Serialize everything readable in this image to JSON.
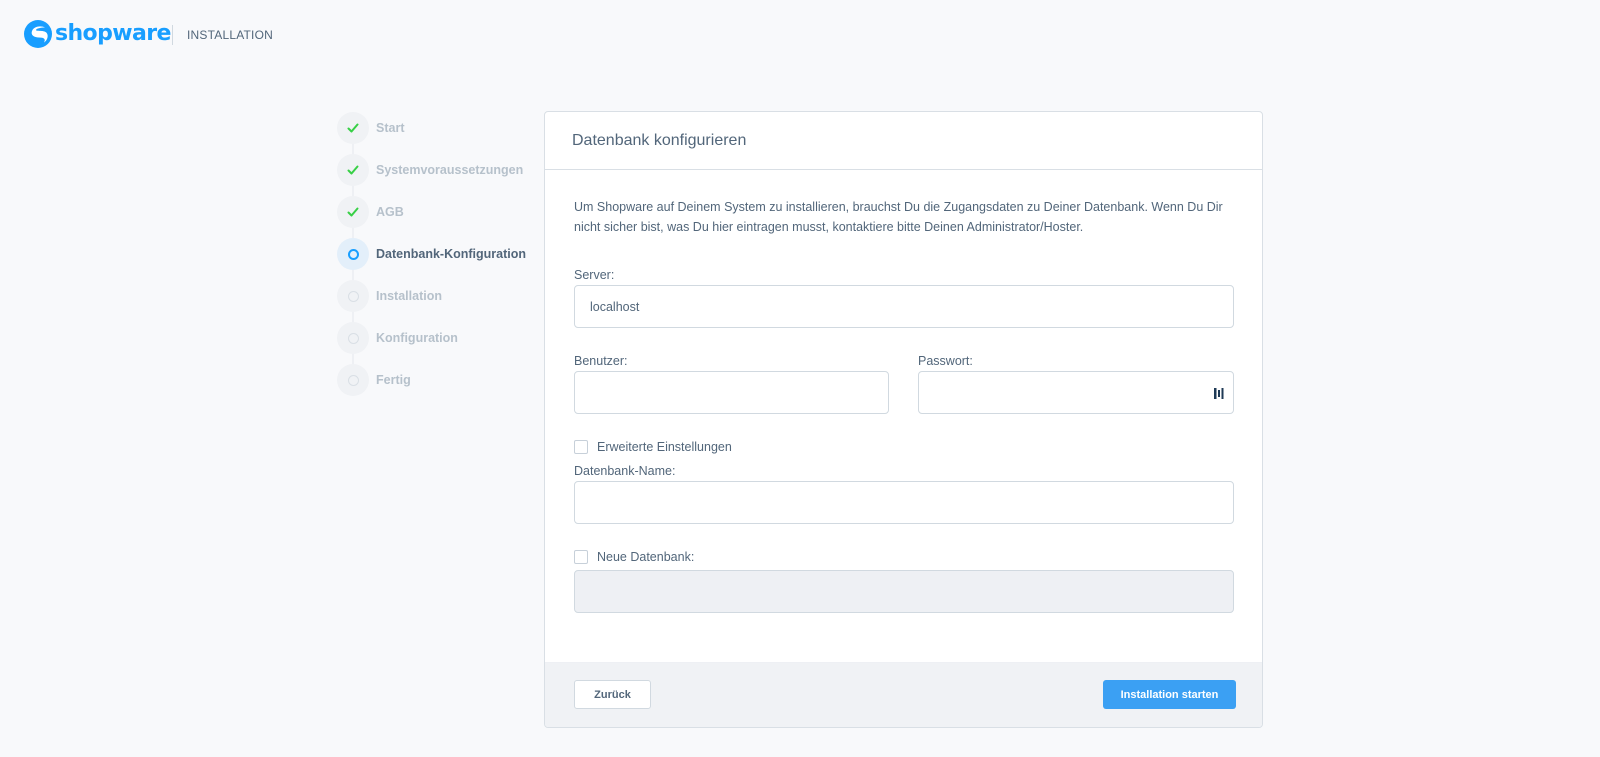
{
  "header": {
    "brand": "shopware",
    "section_label": "INSTALLATION",
    "brand_color": "#189eff"
  },
  "steps": [
    {
      "label": "Start",
      "status": "done"
    },
    {
      "label": "Systemvoraussetzungen",
      "status": "done"
    },
    {
      "label": "AGB",
      "status": "done"
    },
    {
      "label": "Datenbank-Konfiguration",
      "status": "current"
    },
    {
      "label": "Installation",
      "status": "pending"
    },
    {
      "label": "Konfiguration",
      "status": "pending"
    },
    {
      "label": "Fertig",
      "status": "pending"
    }
  ],
  "card": {
    "title": "Datenbank konfigurieren",
    "intro": "Um Shopware auf Deinem System zu installieren, brauchst Du die Zugangsdaten zu Deiner Datenbank. Wenn Du Dir nicht sicher bist, was Du hier eintragen musst, kontaktiere bitte Deinen Administrator/Hoster."
  },
  "form": {
    "server_label": "Server:",
    "server_value": "localhost",
    "user_label": "Benutzer:",
    "user_value": "",
    "password_label": "Passwort:",
    "password_value": "",
    "advanced_label": "Erweiterte Einstellungen",
    "advanced_checked": false,
    "dbname_label": "Datenbank-Name:",
    "dbname_value": "",
    "newdb_label": "Neue Datenbank:",
    "newdb_checked": false,
    "newdb_value": ""
  },
  "footer": {
    "back_label": "Zurück",
    "submit_label": "Installation starten",
    "accent_color": "#3ba0f3"
  },
  "colors": {
    "done_check": "#37d046",
    "current_ring": "#189eff"
  }
}
